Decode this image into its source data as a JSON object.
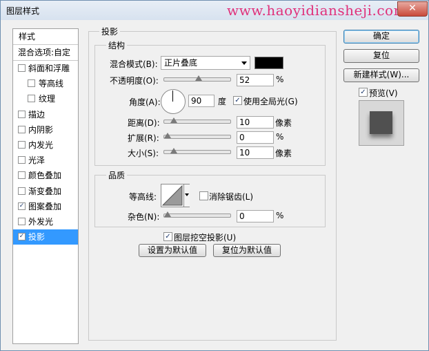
{
  "window": {
    "title": "图层样式",
    "watermark": "www.haoyidiansheji.com",
    "close_glyph": "✕"
  },
  "style_list": {
    "header": "样式",
    "blend_options": "混合选项:自定",
    "items": [
      {
        "label": "斜面和浮雕",
        "checked": false,
        "indent": false
      },
      {
        "label": "等高线",
        "checked": false,
        "indent": true
      },
      {
        "label": "纹理",
        "checked": false,
        "indent": true
      },
      {
        "label": "描边",
        "checked": false,
        "indent": false
      },
      {
        "label": "内阴影",
        "checked": false,
        "indent": false
      },
      {
        "label": "内发光",
        "checked": false,
        "indent": false
      },
      {
        "label": "光泽",
        "checked": false,
        "indent": false
      },
      {
        "label": "颜色叠加",
        "checked": false,
        "indent": false
      },
      {
        "label": "渐变叠加",
        "checked": false,
        "indent": false
      },
      {
        "label": "图案叠加",
        "checked": true,
        "indent": false
      },
      {
        "label": "外发光",
        "checked": false,
        "indent": false
      },
      {
        "label": "投影",
        "checked": true,
        "indent": false,
        "selected": true
      }
    ]
  },
  "panel": {
    "title": "投影",
    "structure": {
      "title": "结构",
      "blend_mode_label": "混合模式(B):",
      "blend_mode_value": "正片叠底",
      "shadow_color": "#000000",
      "opacity_label": "不透明度(O):",
      "opacity_value": "52",
      "opacity_unit": "%",
      "angle_label": "角度(A):",
      "angle_value": "90",
      "angle_unit": "度",
      "global_light_label": "使用全局光(G)",
      "global_light_checked": true,
      "distance_label": "距离(D):",
      "distance_value": "10",
      "distance_unit": "像素",
      "spread_label": "扩展(R):",
      "spread_value": "0",
      "spread_unit": "%",
      "size_label": "大小(S):",
      "size_value": "10",
      "size_unit": "像素"
    },
    "quality": {
      "title": "品质",
      "contour_label": "等高线:",
      "anti_alias_label": "消除锯齿(L)",
      "anti_alias_checked": false,
      "noise_label": "杂色(N):",
      "noise_value": "0",
      "noise_unit": "%"
    },
    "knockout_label": "图层挖空投影(U)",
    "knockout_checked": true,
    "make_default_label": "设置为默认值",
    "reset_default_label": "复位为默认值"
  },
  "buttons": {
    "ok": "确定",
    "reset": "复位",
    "new_style": "新建样式(W)...",
    "preview_label": "预览(V)",
    "preview_checked": true
  },
  "check_glyph": "✓"
}
